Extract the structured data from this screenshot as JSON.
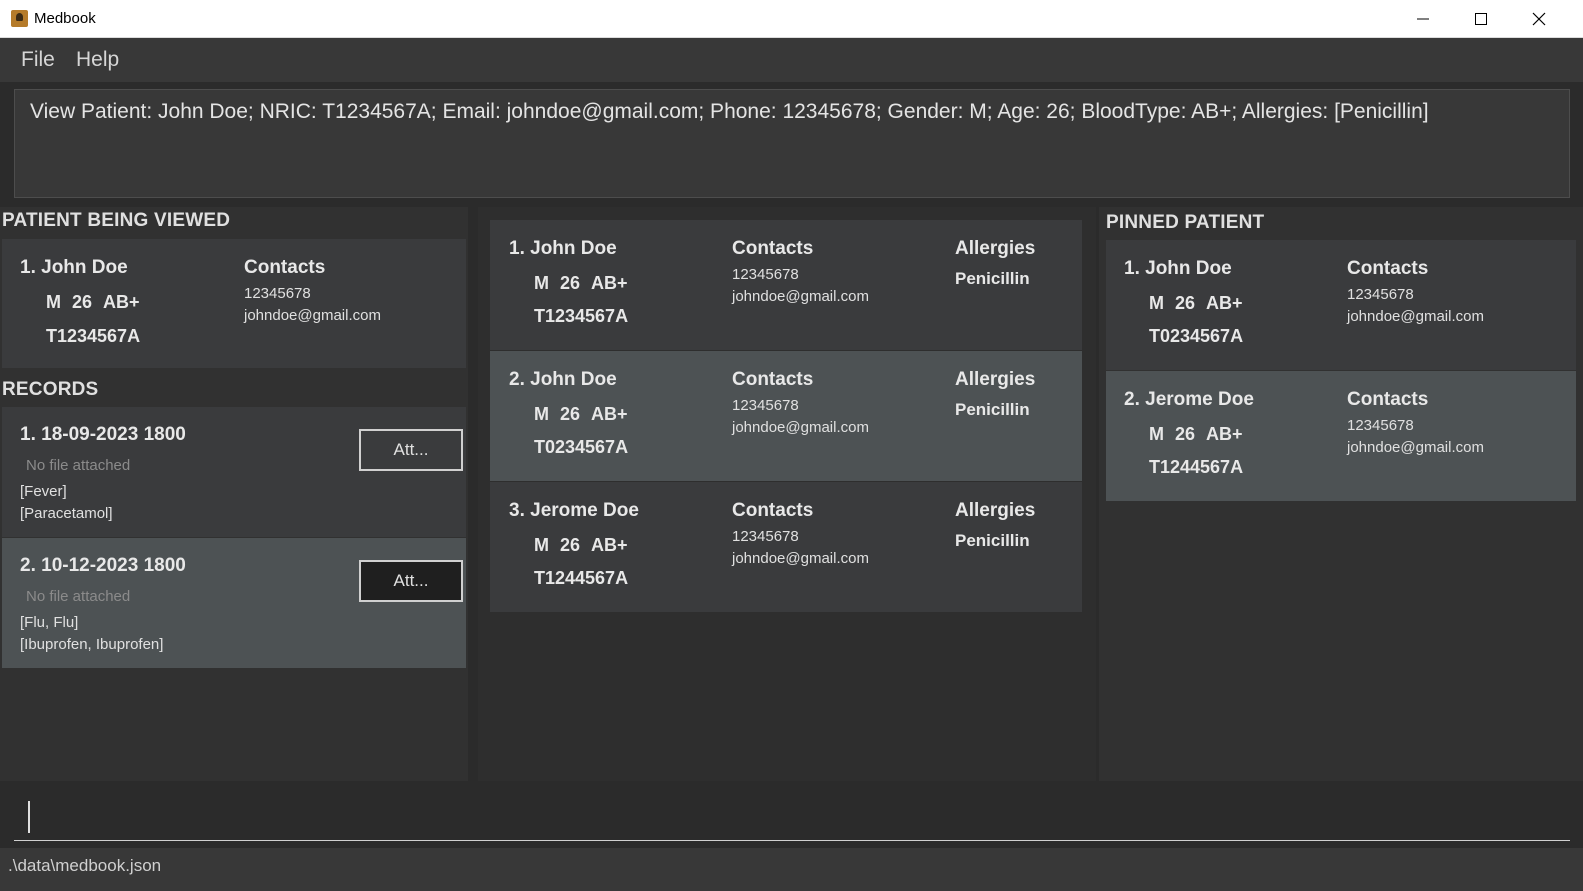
{
  "window": {
    "title": "Medbook"
  },
  "menu": {
    "file": "File",
    "help": "Help"
  },
  "result_text": "View Patient: John Doe; NRIC: T1234567A; Email: johndoe@gmail.com; Phone: 12345678; Gender: M; Age: 26; BloodType: AB+; Allergies: [Penicillin]",
  "viewed": {
    "title": "PATIENT BEING VIEWED",
    "name": "1. John Doe",
    "gender": "M",
    "age": "26",
    "blood": "AB+",
    "nric": "T1234567A",
    "contacts_label": "Contacts",
    "phone": "12345678",
    "email": "johndoe@gmail.com"
  },
  "records": {
    "title": "RECORDS",
    "attach_label": "Att...",
    "items": [
      {
        "date": "1. 18-09-2023 1800",
        "file": "No file attached",
        "conditions": "[Fever]",
        "medications": "[Paracetamol]"
      },
      {
        "date": "2. 10-12-2023 1800",
        "file": "No file attached",
        "conditions": "[Flu, Flu]",
        "medications": "[Ibuprofen, Ibuprofen]"
      }
    ]
  },
  "patients": [
    {
      "name": "1. John Doe",
      "gender": "M",
      "age": "26",
      "blood": "AB+",
      "nric": "T1234567A",
      "contacts_label": "Contacts",
      "phone": "12345678",
      "email": "johndoe@gmail.com",
      "allergies_label": "Allergies",
      "allergy": "Penicillin"
    },
    {
      "name": "2. John Doe",
      "gender": "M",
      "age": "26",
      "blood": "AB+",
      "nric": "T0234567A",
      "contacts_label": "Contacts",
      "phone": "12345678",
      "email": "johndoe@gmail.com",
      "allergies_label": "Allergies",
      "allergy": "Penicillin"
    },
    {
      "name": "3. Jerome Doe",
      "gender": "M",
      "age": "26",
      "blood": "AB+",
      "nric": "T1244567A",
      "contacts_label": "Contacts",
      "phone": "12345678",
      "email": "johndoe@gmail.com",
      "allergies_label": "Allergies",
      "allergy": "Penicillin"
    }
  ],
  "pinned": {
    "title": "PINNED PATIENT",
    "items": [
      {
        "name": "1. John Doe",
        "gender": "M",
        "age": "26",
        "blood": "AB+",
        "nric": "T0234567A",
        "contacts_label": "Contacts",
        "phone": "12345678",
        "email": "johndoe@gmail.com"
      },
      {
        "name": "2. Jerome Doe",
        "gender": "M",
        "age": "26",
        "blood": "AB+",
        "nric": "T1244567A",
        "contacts_label": "Contacts",
        "phone": "12345678",
        "email": "johndoe@gmail.com"
      }
    ]
  },
  "status": {
    "file_path": ".\\data\\medbook.json"
  },
  "colors": {
    "card_dark": "#3a3b3d",
    "card_selected": "#4d5254",
    "panel": "#313131",
    "background": "#2b2b2b"
  }
}
